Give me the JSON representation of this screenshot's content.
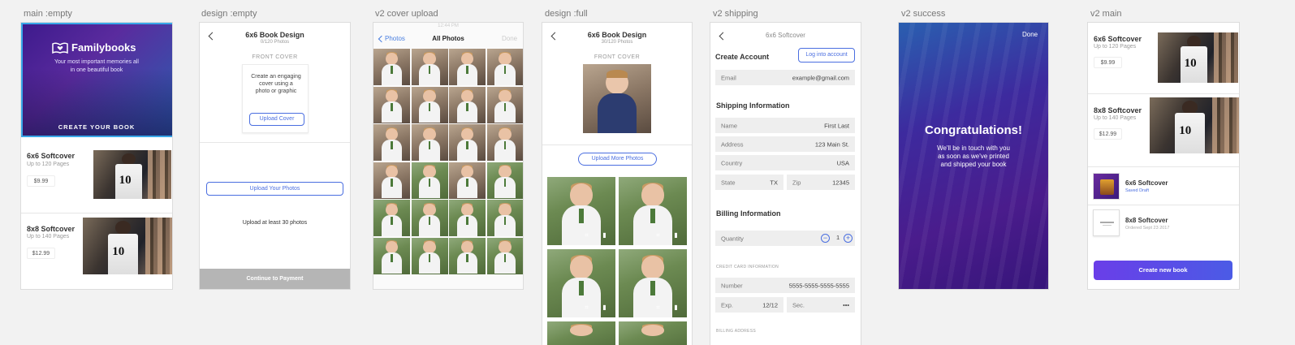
{
  "labels": {
    "main_empty": "main :empty",
    "design_empty": "design :empty",
    "v2_cover_upload": "v2 cover upload",
    "design_full": "design :full",
    "v2_shipping": "v2 shipping",
    "v2_success": "v2 success",
    "v2_main": "v2 main"
  },
  "main_empty": {
    "brand": "Familybooks",
    "tagline_1": "Your most important memories all",
    "tagline_2": "in one beautiful book",
    "cta": "CREATE YOUR BOOK",
    "products": [
      {
        "title": "6x6 Softcover",
        "pages": "Up to 120 Pages",
        "price": "$9.99"
      },
      {
        "title": "8x8 Softcover",
        "pages": "Up to 140 Pages",
        "price": "$12.99"
      }
    ]
  },
  "design_empty": {
    "title": "6x6 Book Design",
    "subtitle": "0/120 Photos",
    "front_cover": "FRONT COVER",
    "cover_hint_1": "Create an engaging",
    "cover_hint_2": "cover using a",
    "cover_hint_3": "photo or graphic",
    "upload_cover": "Upload Cover",
    "upload_photos": "Upload Your Photos",
    "upload_min": "Upload at least 30 photos",
    "continue": "Continue to Payment"
  },
  "cover_upload": {
    "status_time": "12:44 PM",
    "back": "Photos",
    "title": "All Photos",
    "done": "Done"
  },
  "design_full": {
    "title": "6x6 Book Design",
    "subtitle": "30/120 Photos",
    "front_cover": "FRONT COVER",
    "upload_more": "Upload More Photos"
  },
  "shipping": {
    "header": "6x6 Softcover",
    "create_account": "Create Account",
    "login": "Log into account",
    "email_label": "Email",
    "email_value": "example@gmail.com",
    "shipping_title": "Shipping Information",
    "name_label": "Name",
    "name_value": "First Last",
    "address_label": "Address",
    "address_value": "123 Main St.",
    "country_label": "Country",
    "country_value": "USA",
    "state_label": "State",
    "state_value": "TX",
    "zip_label": "Zip",
    "zip_value": "12345",
    "billing_title": "Billing Information",
    "quantity_label": "Quantity",
    "quantity_value": "1",
    "cc_header": "CREDIT CARD INFORMATION",
    "number_label": "Number",
    "number_value": "5555-5555-5555-5555",
    "exp_label": "Exp.",
    "exp_value": "12/12",
    "sec_label": "Sec.",
    "sec_value": "•••",
    "billing_address": "BILLING ADDRESS"
  },
  "success": {
    "done": "Done",
    "title": "Congratulations!",
    "line1": "We'll be in touch with you",
    "line2": "as soon as we've printed",
    "line3": "and shipped your book"
  },
  "v2_main": {
    "products": [
      {
        "title": "6x6 Softcover",
        "pages": "Up to 120 Pages",
        "price": "$9.99"
      },
      {
        "title": "8x8 Softcover",
        "pages": "Up to 140 Pages",
        "price": "$12.99"
      }
    ],
    "orders": [
      {
        "title": "6x6 Softcover",
        "status": "Saved Draft"
      },
      {
        "title": "8x8 Softcover",
        "status": "Ordered Sept 23 2017"
      }
    ],
    "create_new": "Create new book"
  },
  "colors": {
    "accent": "#4a6ee0",
    "hero_purple": "#3d1a8c",
    "hero_blue": "#1d6fb0",
    "selection": "#39a7e8",
    "create_btn": "#6a3ee8"
  }
}
